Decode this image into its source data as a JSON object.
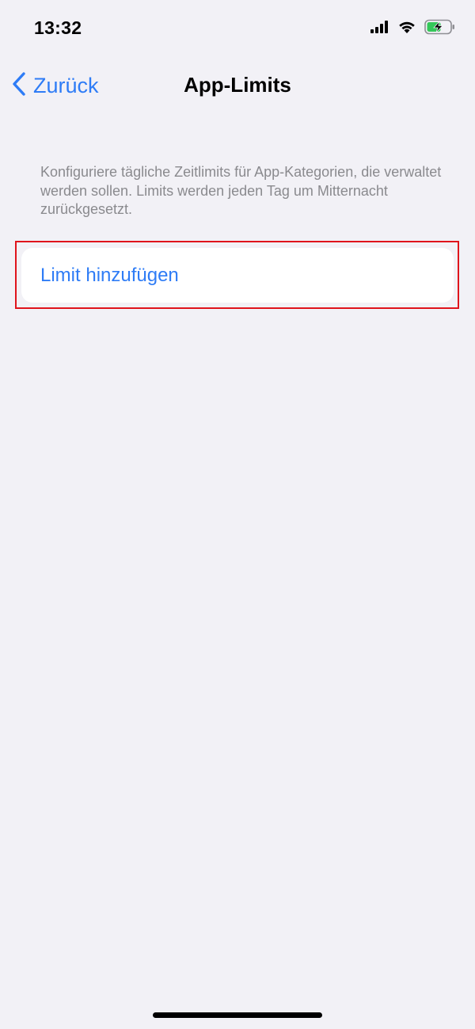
{
  "status_bar": {
    "time": "13:32",
    "icons": [
      "cellular-signal-icon",
      "wifi-icon",
      "battery-charging-icon"
    ]
  },
  "nav": {
    "back_label": "Zurück",
    "title": "App-Limits"
  },
  "content": {
    "description": "Konfiguriere tägliche Zeitlimits für App-Kategorien, die verwaltet werden sollen. Limits werden jeden Tag um Mitternacht zurückgesetzt.",
    "add_limit_label": "Limit hinzufügen"
  },
  "colors": {
    "accent": "#2e7cf6",
    "background": "#f2f1f6",
    "highlight": "#e0141c",
    "battery_fill": "#34c759"
  }
}
